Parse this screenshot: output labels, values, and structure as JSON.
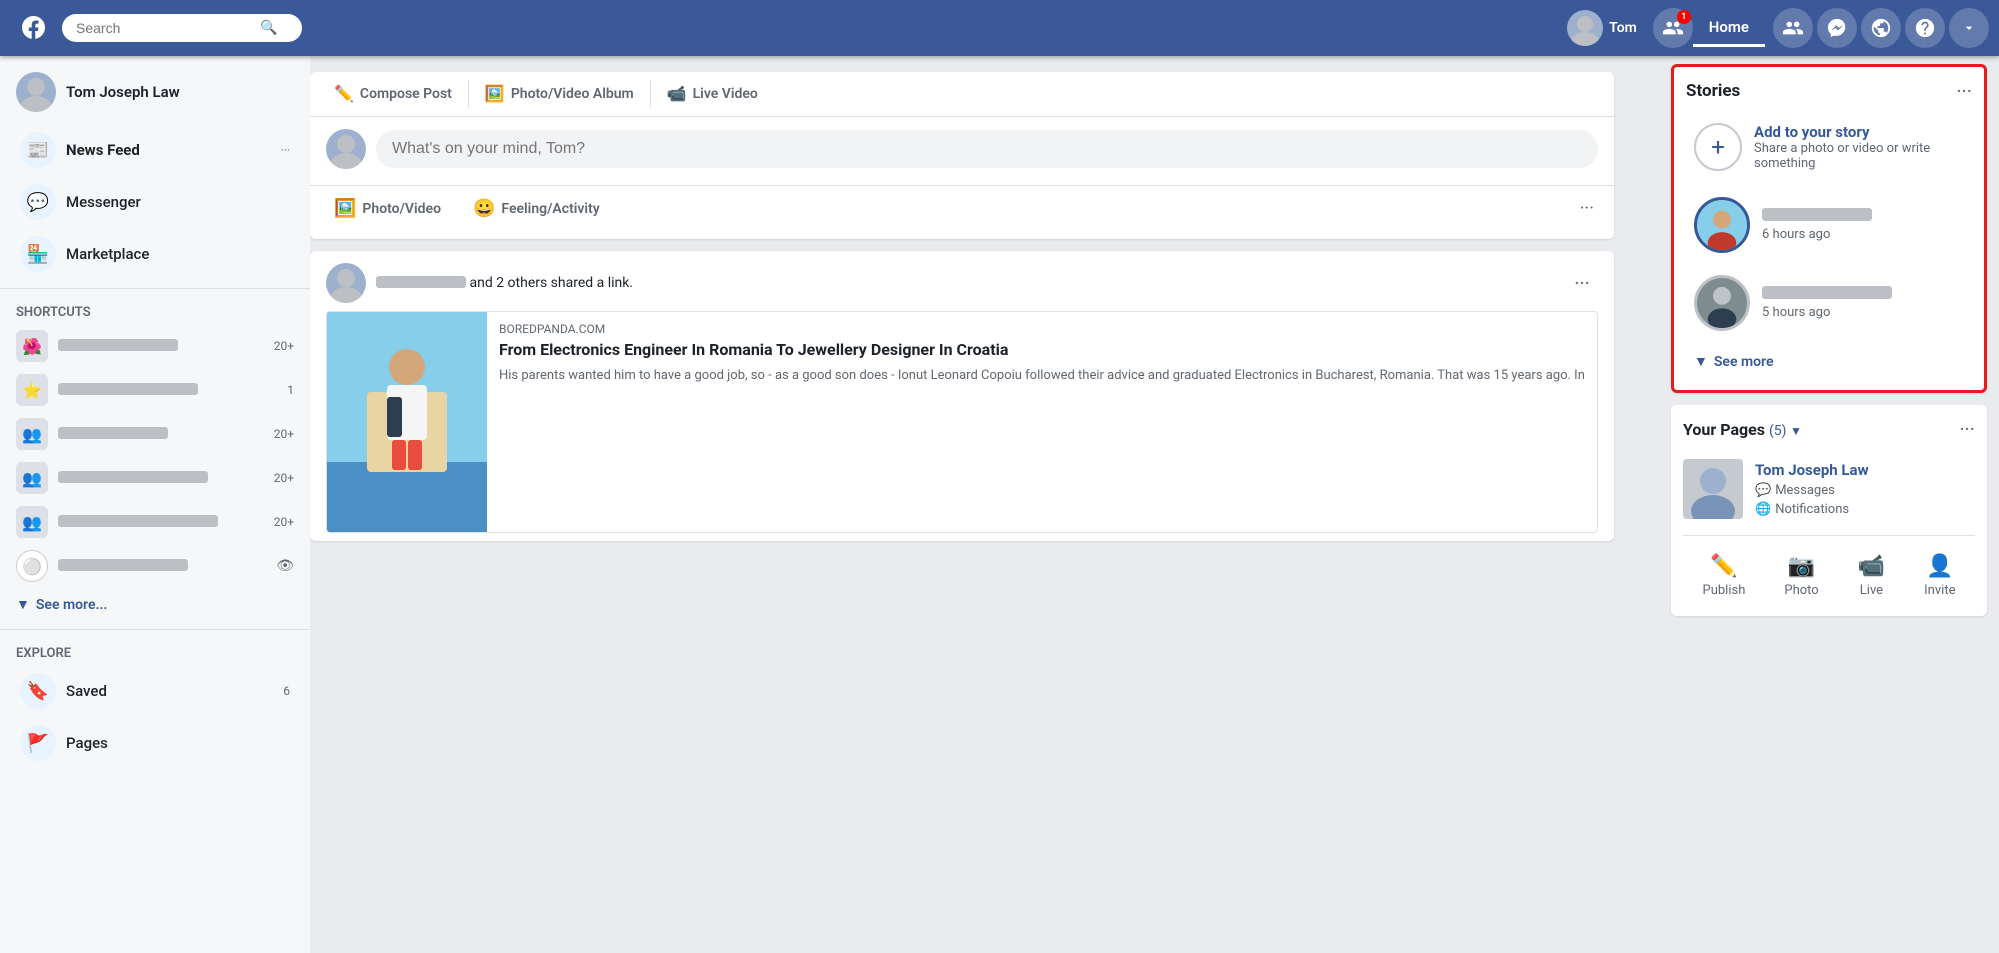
{
  "topnav": {
    "logo": "f",
    "search_placeholder": "Search",
    "user_name": "Tom",
    "home_label": "Home",
    "nav_icons": [
      "friends",
      "messenger",
      "globe",
      "question",
      "chevron-down"
    ]
  },
  "sidebar": {
    "profile_name": "Tom Joseph Law",
    "items": [
      {
        "id": "newsfeed",
        "label": "News Feed",
        "icon": "📰",
        "active": true
      },
      {
        "id": "messenger",
        "label": "Messenger",
        "icon": "💬"
      },
      {
        "id": "marketplace",
        "label": "Marketplace",
        "icon": "🏪"
      }
    ],
    "shortcuts_title": "Shortcuts",
    "shortcuts": [
      {
        "label": "",
        "count": "20+"
      },
      {
        "label": "",
        "count": "1"
      },
      {
        "label": "",
        "count": "20+"
      },
      {
        "label": "",
        "count": "20+"
      },
      {
        "label": "",
        "count": "20+"
      },
      {
        "label": "",
        "count": ""
      }
    ],
    "see_more": "See more...",
    "explore_title": "Explore",
    "explore_items": [
      {
        "id": "saved",
        "label": "Saved",
        "icon": "🔖",
        "count": "6"
      },
      {
        "id": "pages",
        "label": "Pages",
        "icon": "🚩"
      }
    ]
  },
  "compose": {
    "placeholder": "What's on your mind, Tom?",
    "tabs": [
      {
        "id": "compose-post",
        "label": "Compose Post",
        "icon": "✏️"
      },
      {
        "id": "photo-video",
        "label": "Photo/Video Album",
        "icon": "🖼️"
      },
      {
        "id": "live-video",
        "label": "Live Video",
        "icon": "📹"
      }
    ],
    "actions": [
      {
        "id": "photo-video-btn",
        "label": "Photo/Video",
        "icon": "🖼️"
      },
      {
        "id": "feeling-btn",
        "label": "Feeling/Activity",
        "icon": "😀"
      }
    ]
  },
  "post": {
    "shared_text": " and 2 others shared a link.",
    "author_blurred": true,
    "link": {
      "domain": "BOREDPANDA.COM",
      "title": "From Electronics Engineer In Romania To Jewellery Designer In Croatia",
      "description": "His parents wanted him to have a good job, so - as a good son does - Ionut Leonard Copoiu followed their advice and graduated Electronics in Bucharest, Romania. That was 15 years ago. In"
    }
  },
  "stories": {
    "title": "Stories",
    "add_title": "Add to your story",
    "add_desc": "Share a photo or video or write something",
    "see_more": "See more",
    "items": [
      {
        "id": "story1",
        "time": "6 hours ago"
      },
      {
        "id": "story2",
        "time": "5 hours ago"
      }
    ]
  },
  "pages": {
    "title": "Your Pages",
    "count_label": "(5)",
    "page_name": "Tom Joseph Law",
    "actions": [
      {
        "id": "publish",
        "label": "Publish",
        "icon": "✏️"
      },
      {
        "id": "photo",
        "label": "Photo",
        "icon": "📷"
      },
      {
        "id": "live",
        "label": "Live",
        "icon": "📹"
      },
      {
        "id": "invite",
        "label": "Invite",
        "icon": "👤+"
      }
    ],
    "page_actions": [
      {
        "label": "Messages",
        "icon": "💬"
      },
      {
        "label": "Notifications",
        "icon": "🌐"
      }
    ]
  }
}
